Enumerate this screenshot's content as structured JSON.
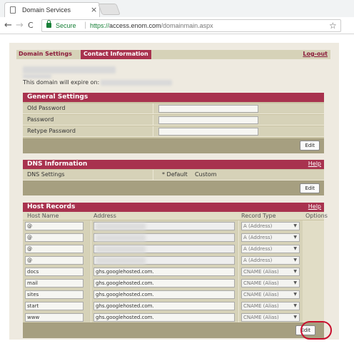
{
  "browser": {
    "tab_title": "Domain Services",
    "tab_close": "×",
    "secure_label": "Secure",
    "url_protocol": "https://",
    "url_host": "access.enom.com",
    "url_path": "/domainmain.aspx",
    "back": "←",
    "forward": "→",
    "reload": "C",
    "star": "☆"
  },
  "nav": {
    "tab_domain_settings": "Domain Settings",
    "tab_contact_information": "Contact Information",
    "logout": "Log-out"
  },
  "domain": {
    "expire_label": "This domain will expire on:"
  },
  "general_settings": {
    "title": "General Settings",
    "fields": [
      {
        "label": "Old Password"
      },
      {
        "label": "Password"
      },
      {
        "label": "Retype Password"
      }
    ],
    "edit_label": "Edit"
  },
  "dns_information": {
    "title": "DNS Information",
    "help": "Help",
    "row_label": "DNS Settings",
    "option_default": "* Default",
    "option_custom": "Custom",
    "edit_label": "Edit"
  },
  "host_records": {
    "title": "Host Records",
    "help": "Help",
    "columns": [
      "Host Name",
      "Address",
      "Record Type",
      "Options"
    ],
    "rows": [
      {
        "host": "@",
        "address": "",
        "type": "A (Address)"
      },
      {
        "host": "@",
        "address": "",
        "type": "A (Address)"
      },
      {
        "host": "@",
        "address": "",
        "type": "A (Address)"
      },
      {
        "host": "@",
        "address": "",
        "type": "A (Address)"
      },
      {
        "host": "docs",
        "address": "ghs.googlehosted.com.",
        "type": "CNAME (Alias)"
      },
      {
        "host": "mail",
        "address": "ghs.googlehosted.com.",
        "type": "CNAME (Alias)"
      },
      {
        "host": "sites",
        "address": "ghs.googlehosted.com.",
        "type": "CNAME (Alias)"
      },
      {
        "host": "start",
        "address": "ghs.googlehosted.com.",
        "type": "CNAME (Alias)"
      },
      {
        "host": "www",
        "address": "ghs.googlehosted.com.",
        "type": "CNAME (Alias)"
      }
    ],
    "edit_label": "Edit"
  },
  "colors": {
    "accent": "#a8324e",
    "panel_bg": "#d6d2b8",
    "footer_bg": "#a69f80",
    "highlight": "#c8102e"
  }
}
